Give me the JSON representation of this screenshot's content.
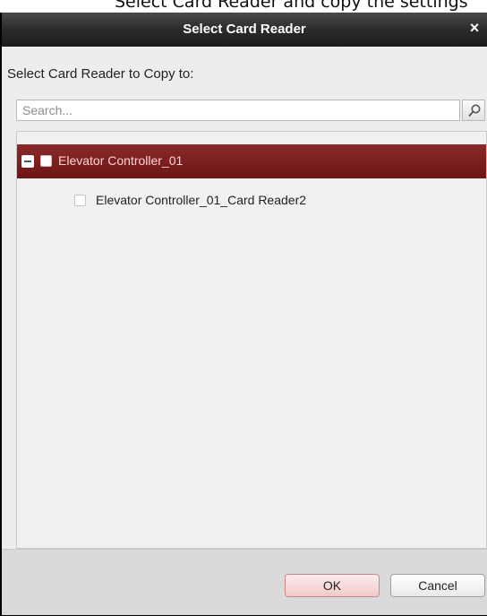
{
  "background_caption": "Select Card Reader and copy the settings",
  "dialog": {
    "title": "Select Card Reader",
    "close_symbol": "×",
    "prompt": "Select Card Reader to Copy to:",
    "search": {
      "placeholder": "Search...",
      "value": "",
      "icon": "search-icon"
    },
    "tree": [
      {
        "label": "Elevator Controller_01",
        "expanded": true,
        "checked": false,
        "selected": true,
        "children": [
          {
            "label": "Elevator Controller_01_Card Reader2",
            "checked": false
          }
        ]
      }
    ],
    "buttons": {
      "ok": "OK",
      "cancel": "Cancel"
    }
  },
  "colors": {
    "titlebar": "#2b2b2b",
    "selected_row": "#7d1f1f",
    "dialog_bg": "#ededed",
    "ok_button": "#f3caca"
  }
}
